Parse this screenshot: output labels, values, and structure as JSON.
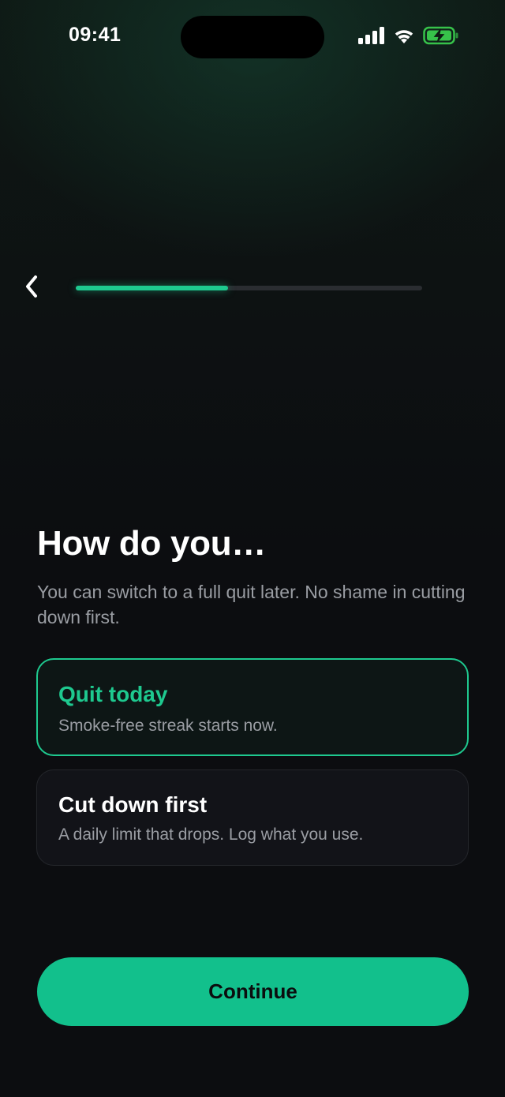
{
  "status_bar": {
    "time": "09:41",
    "icons": [
      "cellular-signal-icon",
      "wifi-icon",
      "battery-charging-icon"
    ],
    "battery_color": "#37c24a"
  },
  "navigation": {
    "back_icon": "chevron-left-icon",
    "progress_fraction": 0.44
  },
  "heading": {
    "title": "How do you…",
    "subtitle": "You can switch to a full quit later. No shame in cutting down first."
  },
  "options": [
    {
      "title": "Quit today",
      "description": "Smoke-free streak starts now.",
      "selected": true
    },
    {
      "title": "Cut down first",
      "description": "A daily limit that drops. Log what you use.",
      "selected": false
    }
  ],
  "continue_label": "Continue",
  "colors": {
    "accent": "#1ec98f",
    "button": "#12c08c",
    "background": "#0c0d10",
    "text_secondary": "#9a9da3"
  }
}
